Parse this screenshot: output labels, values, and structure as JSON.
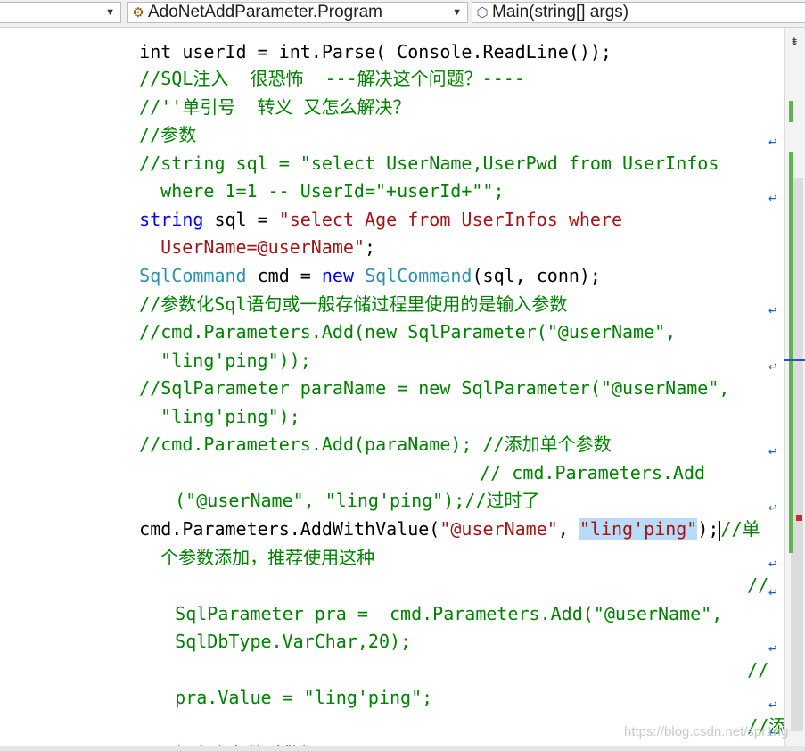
{
  "navbar": {
    "project_combo": "",
    "type_combo": "AdoNetAddParameter.Program",
    "member_combo": "Main(string[] args)"
  },
  "code": {
    "partial_top": "int userId = int.Parse( Console.ReadLine());",
    "l1": "//SQL注入  很恐怖  ---解决这个问题？----",
    "l2": "//''单引号  转义 又怎么解决？",
    "l3": "//参数",
    "l4a": "//string sql = \"select UserName,UserPwd from UserInfos",
    "l4b": "where 1=1 -- UserId=\"+userId+\"\";",
    "l5_kw": "string",
    "l5_rest": " sql = ",
    "l5_str": "\"select Age from UserInfos where",
    "l5b_str": "UserName=@userName\"",
    "l5b_end": ";",
    "l6_type1": "SqlCommand",
    "l6_mid": " cmd = ",
    "l6_kw": "new",
    "l6_sp": " ",
    "l6_type2": "SqlCommand",
    "l6_end": "(sql, conn);",
    "l7": "//参数化Sql语句或一般存储过程里使用的是输入参数",
    "l8a": "//cmd.Parameters.Add(new SqlParameter(\"@userName\",",
    "l8b": "\"ling'ping\"));",
    "l9a": "//SqlParameter paraName = new SqlParameter(\"@userName\",",
    "l9b": "\"ling'ping\");",
    "l10": "//cmd.Parameters.Add(paraName); //添加单个参数",
    "l11a": "// cmd.Parameters.Add",
    "l11b": "(\"@userName\", \"ling'ping\");//过时了",
    "l12_pre": "cmd.Parameters.AddWithValue(",
    "l12_str1": "\"@userName\"",
    "l12_comma": ", ",
    "l12_sel": "\"ling'ping\"",
    "l12_close": ");",
    "l12_cm": "//单",
    "l12b": "个参数添加，推荐使用这种",
    "l13": "//",
    "l14a": "SqlParameter pra =  cmd.Parameters.Add(\"@userName\",",
    "l14b": "SqlDbType.VarChar,20);",
    "l15": "//",
    "l16": "pra.Value = \"ling'ping\";",
    "l17": "//添",
    "l18": "加多个参数时敷衍"
  },
  "wrap_glyph": "↩",
  "watermark": "https://blog.csdn.net/spr1ng",
  "colors": {
    "comment": "#008000",
    "keyword": "#0000ff",
    "type": "#2b91af",
    "string": "#a31515",
    "selection": "#b9dbf7",
    "change_bar": "#57b947"
  }
}
